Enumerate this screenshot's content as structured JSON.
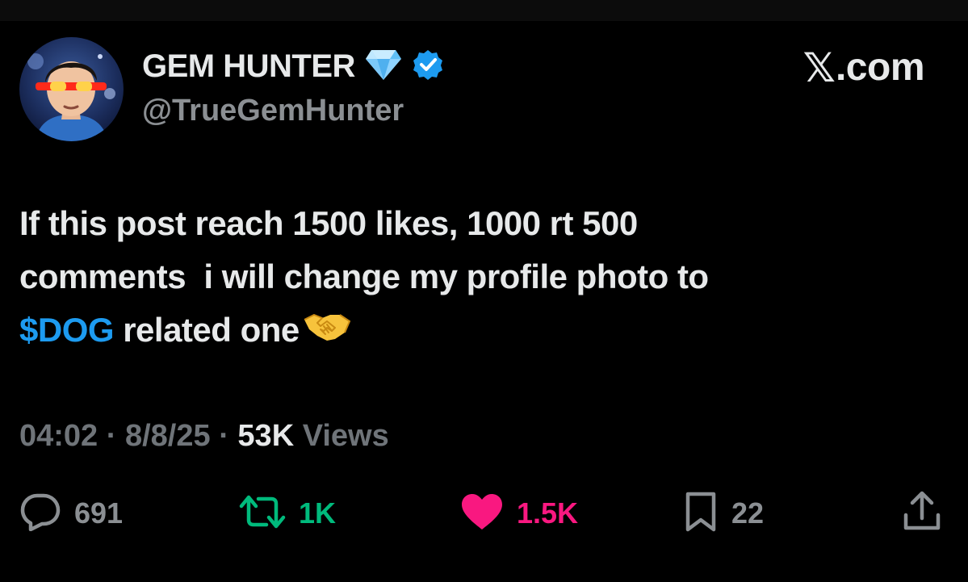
{
  "author": {
    "display_name": "GEM HUNTER",
    "handle": "@TrueGemHunter",
    "badges": [
      "diamond-emoji",
      "verified-icon"
    ]
  },
  "brand": {
    "x_glyph": "𝕏",
    "suffix": ".com"
  },
  "post": {
    "line1": "If this post reach 1500 likes, 1000 rt 500",
    "line2": "comments  i will change my profile photo to",
    "cashtag": "$DOG",
    "line3_rest": " related one",
    "emoji": "handshake-emoji"
  },
  "meta": {
    "time": "04:02",
    "sep1": " · ",
    "date": "8/8/25",
    "sep2": " · ",
    "views_count": "53K",
    "views_label": " Views"
  },
  "actions": {
    "replies": "691",
    "reposts": "1K",
    "likes": "1.5K",
    "bookmarks": "22"
  },
  "colors": {
    "background": "#000000",
    "text": "#e7e9ea",
    "muted": "#8b8f93",
    "link": "#1d9bf0",
    "repost": "#00ba7c",
    "like": "#f91880",
    "verified": "#1d9bf0"
  }
}
